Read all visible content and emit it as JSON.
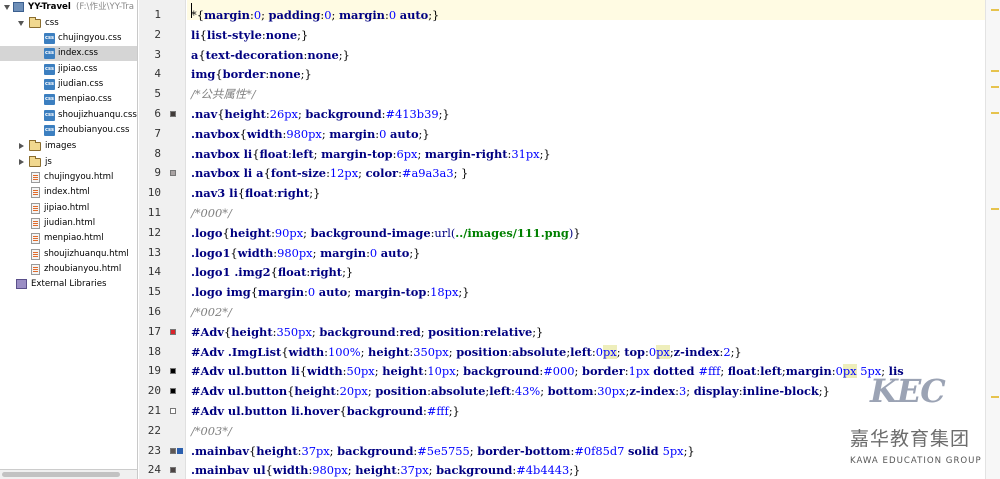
{
  "project_tree": {
    "root_name": "YY-Travel",
    "root_path": "(F:\\作业\\YY-Tra",
    "css_folder": "css",
    "css_files": [
      "chujingyou.css",
      "index.css",
      "jipiao.css",
      "jiudian.css",
      "menpiao.css",
      "shoujizhuanqu.css",
      "zhoubianyou.css"
    ],
    "selected_file": "index.css",
    "images_folder": "images",
    "js_folder": "js",
    "html_files": [
      "chujingyou.html",
      "index.html",
      "jipiao.html",
      "jiudian.html",
      "menpiao.html",
      "shoujizhuanqu.html",
      "zhoubianyou.html"
    ],
    "external_libraries": "External Libraries"
  },
  "editor": {
    "line_numbers": [
      "1",
      "2",
      "3",
      "4",
      "5",
      "6",
      "7",
      "8",
      "9",
      "10",
      "11",
      "12",
      "13",
      "14",
      "15",
      "16",
      "17",
      "18",
      "19",
      "20",
      "21",
      "22",
      "23",
      "24"
    ],
    "lines": [
      [
        [
          "*",
          "c-b"
        ],
        [
          "{",
          "c-b"
        ],
        [
          "margin",
          "c-p"
        ],
        [
          ":",
          "c-b"
        ],
        [
          "0",
          "c-n"
        ],
        [
          "; ",
          "c-b"
        ],
        [
          "padding",
          "c-p"
        ],
        [
          ":",
          "c-b"
        ],
        [
          "0",
          "c-n"
        ],
        [
          "; ",
          "c-b"
        ],
        [
          "margin",
          "c-p"
        ],
        [
          ":",
          "c-b"
        ],
        [
          "0 ",
          "c-n"
        ],
        [
          "auto",
          "c-v"
        ],
        [
          ";}",
          "c-b"
        ]
      ],
      [
        [
          "li",
          "c-s"
        ],
        [
          "{",
          "c-b"
        ],
        [
          "list-style",
          "c-p"
        ],
        [
          ":",
          "c-b"
        ],
        [
          "none",
          "c-v"
        ],
        [
          ";}",
          "c-b"
        ]
      ],
      [
        [
          "a",
          "c-s"
        ],
        [
          "{",
          "c-b"
        ],
        [
          "text-decoration",
          "c-p"
        ],
        [
          ":",
          "c-b"
        ],
        [
          "none",
          "c-v"
        ],
        [
          ";}",
          "c-b"
        ]
      ],
      [
        [
          "img",
          "c-s"
        ],
        [
          "{",
          "c-b"
        ],
        [
          "border",
          "c-p"
        ],
        [
          ":",
          "c-b"
        ],
        [
          "none",
          "c-v"
        ],
        [
          ";}",
          "c-b"
        ]
      ],
      [
        [
          "/*公共属性*/",
          "c-c"
        ]
      ],
      [
        [
          ".nav",
          "c-s"
        ],
        [
          "{",
          "c-b"
        ],
        [
          "height",
          "c-p"
        ],
        [
          ":",
          "c-b"
        ],
        [
          "26px",
          "c-n"
        ],
        [
          "; ",
          "c-b"
        ],
        [
          "background",
          "c-p"
        ],
        [
          ":",
          "c-b"
        ],
        [
          "#413b39",
          "c-n"
        ],
        [
          ";}",
          "c-b"
        ]
      ],
      [
        [
          ".navbox",
          "c-s"
        ],
        [
          "{",
          "c-b"
        ],
        [
          "width",
          "c-p"
        ],
        [
          ":",
          "c-b"
        ],
        [
          "980px",
          "c-n"
        ],
        [
          "; ",
          "c-b"
        ],
        [
          "margin",
          "c-p"
        ],
        [
          ":",
          "c-b"
        ],
        [
          "0 ",
          "c-n"
        ],
        [
          "auto",
          "c-v"
        ],
        [
          ";}",
          "c-b"
        ]
      ],
      [
        [
          ".navbox li",
          "c-s"
        ],
        [
          "{",
          "c-b"
        ],
        [
          "float",
          "c-p"
        ],
        [
          ":",
          "c-b"
        ],
        [
          "left",
          "c-v"
        ],
        [
          "; ",
          "c-b"
        ],
        [
          "margin-top",
          "c-p"
        ],
        [
          ":",
          "c-b"
        ],
        [
          "6px",
          "c-n"
        ],
        [
          "; ",
          "c-b"
        ],
        [
          "margin-right",
          "c-p"
        ],
        [
          ":",
          "c-b"
        ],
        [
          "31px",
          "c-n"
        ],
        [
          ";}",
          "c-b"
        ]
      ],
      [
        [
          ".navbox li a",
          "c-s"
        ],
        [
          "{",
          "c-b"
        ],
        [
          "font-size",
          "c-p"
        ],
        [
          ":",
          "c-b"
        ],
        [
          "12px",
          "c-n"
        ],
        [
          "; ",
          "c-b"
        ],
        [
          "color",
          "c-p"
        ],
        [
          ":",
          "c-b"
        ],
        [
          "#a9a3a3",
          "c-n"
        ],
        [
          "; }",
          "c-b"
        ]
      ],
      [
        [
          ".nav3 li",
          "c-s"
        ],
        [
          "{",
          "c-b"
        ],
        [
          "float",
          "c-p"
        ],
        [
          ":",
          "c-b"
        ],
        [
          "right",
          "c-v"
        ],
        [
          ";}",
          "c-b"
        ]
      ],
      [
        [
          "/*000*/",
          "c-c"
        ]
      ],
      [
        [
          ".logo",
          "c-s"
        ],
        [
          "{",
          "c-b"
        ],
        [
          "height",
          "c-p"
        ],
        [
          ":",
          "c-b"
        ],
        [
          "90px",
          "c-n"
        ],
        [
          "; ",
          "c-b"
        ],
        [
          "background-image",
          "c-p"
        ],
        [
          ":",
          "c-b"
        ],
        [
          "url(",
          "c-k"
        ],
        [
          "../images/111.png",
          "c-str"
        ],
        [
          ")",
          "c-k"
        ],
        [
          "}",
          "c-b"
        ]
      ],
      [
        [
          ".logo1",
          "c-s"
        ],
        [
          "{",
          "c-b"
        ],
        [
          "width",
          "c-p"
        ],
        [
          ":",
          "c-b"
        ],
        [
          "980px",
          "c-n"
        ],
        [
          "; ",
          "c-b"
        ],
        [
          "margin",
          "c-p"
        ],
        [
          ":",
          "c-b"
        ],
        [
          "0 ",
          "c-n"
        ],
        [
          "auto",
          "c-v"
        ],
        [
          ";}",
          "c-b"
        ]
      ],
      [
        [
          ".logo1 .img2",
          "c-s"
        ],
        [
          "{",
          "c-b"
        ],
        [
          "float",
          "c-p"
        ],
        [
          ":",
          "c-b"
        ],
        [
          "right",
          "c-v"
        ],
        [
          ";}",
          "c-b"
        ]
      ],
      [
        [
          ".logo img",
          "c-s"
        ],
        [
          "{",
          "c-b"
        ],
        [
          "margin",
          "c-p"
        ],
        [
          ":",
          "c-b"
        ],
        [
          "0 ",
          "c-n"
        ],
        [
          "auto",
          "c-v"
        ],
        [
          "; ",
          "c-b"
        ],
        [
          "margin-top",
          "c-p"
        ],
        [
          ":",
          "c-b"
        ],
        [
          "18px",
          "c-n"
        ],
        [
          ";}",
          "c-b"
        ]
      ],
      [
        [
          "/*002*/",
          "c-c"
        ]
      ],
      [
        [
          "#Adv",
          "c-s"
        ],
        [
          "{",
          "c-b"
        ],
        [
          "height",
          "c-p"
        ],
        [
          ":",
          "c-b"
        ],
        [
          "350px",
          "c-n"
        ],
        [
          "; ",
          "c-b"
        ],
        [
          "background",
          "c-p"
        ],
        [
          ":",
          "c-b"
        ],
        [
          "red",
          "c-v"
        ],
        [
          "; ",
          "c-b"
        ],
        [
          "position",
          "c-p"
        ],
        [
          ":",
          "c-b"
        ],
        [
          "relative",
          "c-v"
        ],
        [
          ";}",
          "c-b"
        ]
      ],
      [
        [
          "#Adv .ImgList",
          "c-s"
        ],
        [
          "{",
          "c-b"
        ],
        [
          "width",
          "c-p"
        ],
        [
          ":",
          "c-b"
        ],
        [
          "100%",
          "c-n"
        ],
        [
          "; ",
          "c-b"
        ],
        [
          "height",
          "c-p"
        ],
        [
          ":",
          "c-b"
        ],
        [
          "350px",
          "c-n"
        ],
        [
          "; ",
          "c-b"
        ],
        [
          "position",
          "c-p"
        ],
        [
          ":",
          "c-b"
        ],
        [
          "absolute",
          "c-v"
        ],
        [
          ";",
          "c-b"
        ],
        [
          "left",
          "c-p"
        ],
        [
          ":",
          "c-b"
        ],
        [
          "0",
          "c-n"
        ],
        [
          "px",
          "c-n hl"
        ],
        [
          "; ",
          "c-b"
        ],
        [
          "top",
          "c-p"
        ],
        [
          ":",
          "c-b"
        ],
        [
          "0",
          "c-n"
        ],
        [
          "px",
          "c-n hl"
        ],
        [
          ";",
          "c-b"
        ],
        [
          "z-index",
          "c-p"
        ],
        [
          ":",
          "c-b"
        ],
        [
          "2",
          "c-n"
        ],
        [
          ";}",
          "c-b"
        ]
      ],
      [
        [
          "#Adv ul.button li",
          "c-s"
        ],
        [
          "{",
          "c-b"
        ],
        [
          "width",
          "c-p"
        ],
        [
          ":",
          "c-b"
        ],
        [
          "50px",
          "c-n"
        ],
        [
          "; ",
          "c-b"
        ],
        [
          "height",
          "c-p"
        ],
        [
          ":",
          "c-b"
        ],
        [
          "10px",
          "c-n"
        ],
        [
          "; ",
          "c-b"
        ],
        [
          "background",
          "c-p"
        ],
        [
          ":",
          "c-b"
        ],
        [
          "#000",
          "c-n"
        ],
        [
          "; ",
          "c-b"
        ],
        [
          "border",
          "c-p"
        ],
        [
          ":",
          "c-b"
        ],
        [
          "1px ",
          "c-n"
        ],
        [
          "dotted ",
          "c-v"
        ],
        [
          "#fff",
          "c-n"
        ],
        [
          "; ",
          "c-b"
        ],
        [
          "float",
          "c-p"
        ],
        [
          ":",
          "c-b"
        ],
        [
          "left",
          "c-v"
        ],
        [
          ";",
          "c-b"
        ],
        [
          "margin",
          "c-p"
        ],
        [
          ":",
          "c-b"
        ],
        [
          "0",
          "c-n"
        ],
        [
          "px",
          "c-n hl"
        ],
        [
          " 5px",
          "c-n"
        ],
        [
          "; ",
          "c-b"
        ],
        [
          "lis",
          "c-p"
        ]
      ],
      [
        [
          "#Adv ul.button",
          "c-s"
        ],
        [
          "{",
          "c-b"
        ],
        [
          "height",
          "c-p"
        ],
        [
          ":",
          "c-b"
        ],
        [
          "20px",
          "c-n"
        ],
        [
          "; ",
          "c-b"
        ],
        [
          "position",
          "c-p"
        ],
        [
          ":",
          "c-b"
        ],
        [
          "absolute",
          "c-v"
        ],
        [
          ";",
          "c-b"
        ],
        [
          "left",
          "c-p"
        ],
        [
          ":",
          "c-b"
        ],
        [
          "43%",
          "c-n"
        ],
        [
          "; ",
          "c-b"
        ],
        [
          "bottom",
          "c-p"
        ],
        [
          ":",
          "c-b"
        ],
        [
          "30px",
          "c-n"
        ],
        [
          ";",
          "c-b"
        ],
        [
          "z-index",
          "c-p"
        ],
        [
          ":",
          "c-b"
        ],
        [
          "3",
          "c-n"
        ],
        [
          "; ",
          "c-b"
        ],
        [
          "display",
          "c-p"
        ],
        [
          ":",
          "c-b"
        ],
        [
          "inline-block",
          "c-v"
        ],
        [
          ";}",
          "c-b"
        ]
      ],
      [
        [
          "#Adv ul.button li.hover",
          "c-s"
        ],
        [
          "{",
          "c-b"
        ],
        [
          "background",
          "c-p"
        ],
        [
          ":",
          "c-b"
        ],
        [
          "#fff",
          "c-n"
        ],
        [
          ";}",
          "c-b"
        ]
      ],
      [
        [
          "/*003*/",
          "c-c"
        ]
      ],
      [
        [
          ".mainbav",
          "c-s"
        ],
        [
          "{",
          "c-b"
        ],
        [
          "height",
          "c-p"
        ],
        [
          ":",
          "c-b"
        ],
        [
          "37px",
          "c-n"
        ],
        [
          "; ",
          "c-b"
        ],
        [
          "background",
          "c-p"
        ],
        [
          ":",
          "c-b"
        ],
        [
          "#5e5755",
          "c-n"
        ],
        [
          "; ",
          "c-b"
        ],
        [
          "border-bottom",
          "c-p"
        ],
        [
          ":",
          "c-b"
        ],
        [
          "#0f85d7 ",
          "c-n"
        ],
        [
          "solid ",
          "c-v"
        ],
        [
          "5px",
          "c-n"
        ],
        [
          ";}",
          "c-b"
        ]
      ],
      [
        [
          ".mainbav ul",
          "c-s"
        ],
        [
          "{",
          "c-b"
        ],
        [
          "width",
          "c-p"
        ],
        [
          ":",
          "c-b"
        ],
        [
          "980px",
          "c-n"
        ],
        [
          "; ",
          "c-b"
        ],
        [
          "height",
          "c-p"
        ],
        [
          ":",
          "c-b"
        ],
        [
          "37px",
          "c-n"
        ],
        [
          "; ",
          "c-b"
        ],
        [
          "background",
          "c-p"
        ],
        [
          ":",
          "c-b"
        ],
        [
          "#4b4443",
          "c-n"
        ],
        [
          ";}",
          "c-b"
        ]
      ]
    ]
  },
  "watermark": {
    "logo_text": "KEC",
    "chinese_name": "嘉华教育集团",
    "english_name": "KAWA EDUCATION GROUP"
  },
  "colors": {
    "selection": "#d5d5d5",
    "current_line": "#fffbe3",
    "gutter_bg": "#f0f0f0",
    "property": "#000080",
    "number": "#0000ff",
    "comment": "#808080",
    "string": "#008000",
    "marker_red": "#d9232a",
    "marker_blue": "#2b5fae"
  }
}
